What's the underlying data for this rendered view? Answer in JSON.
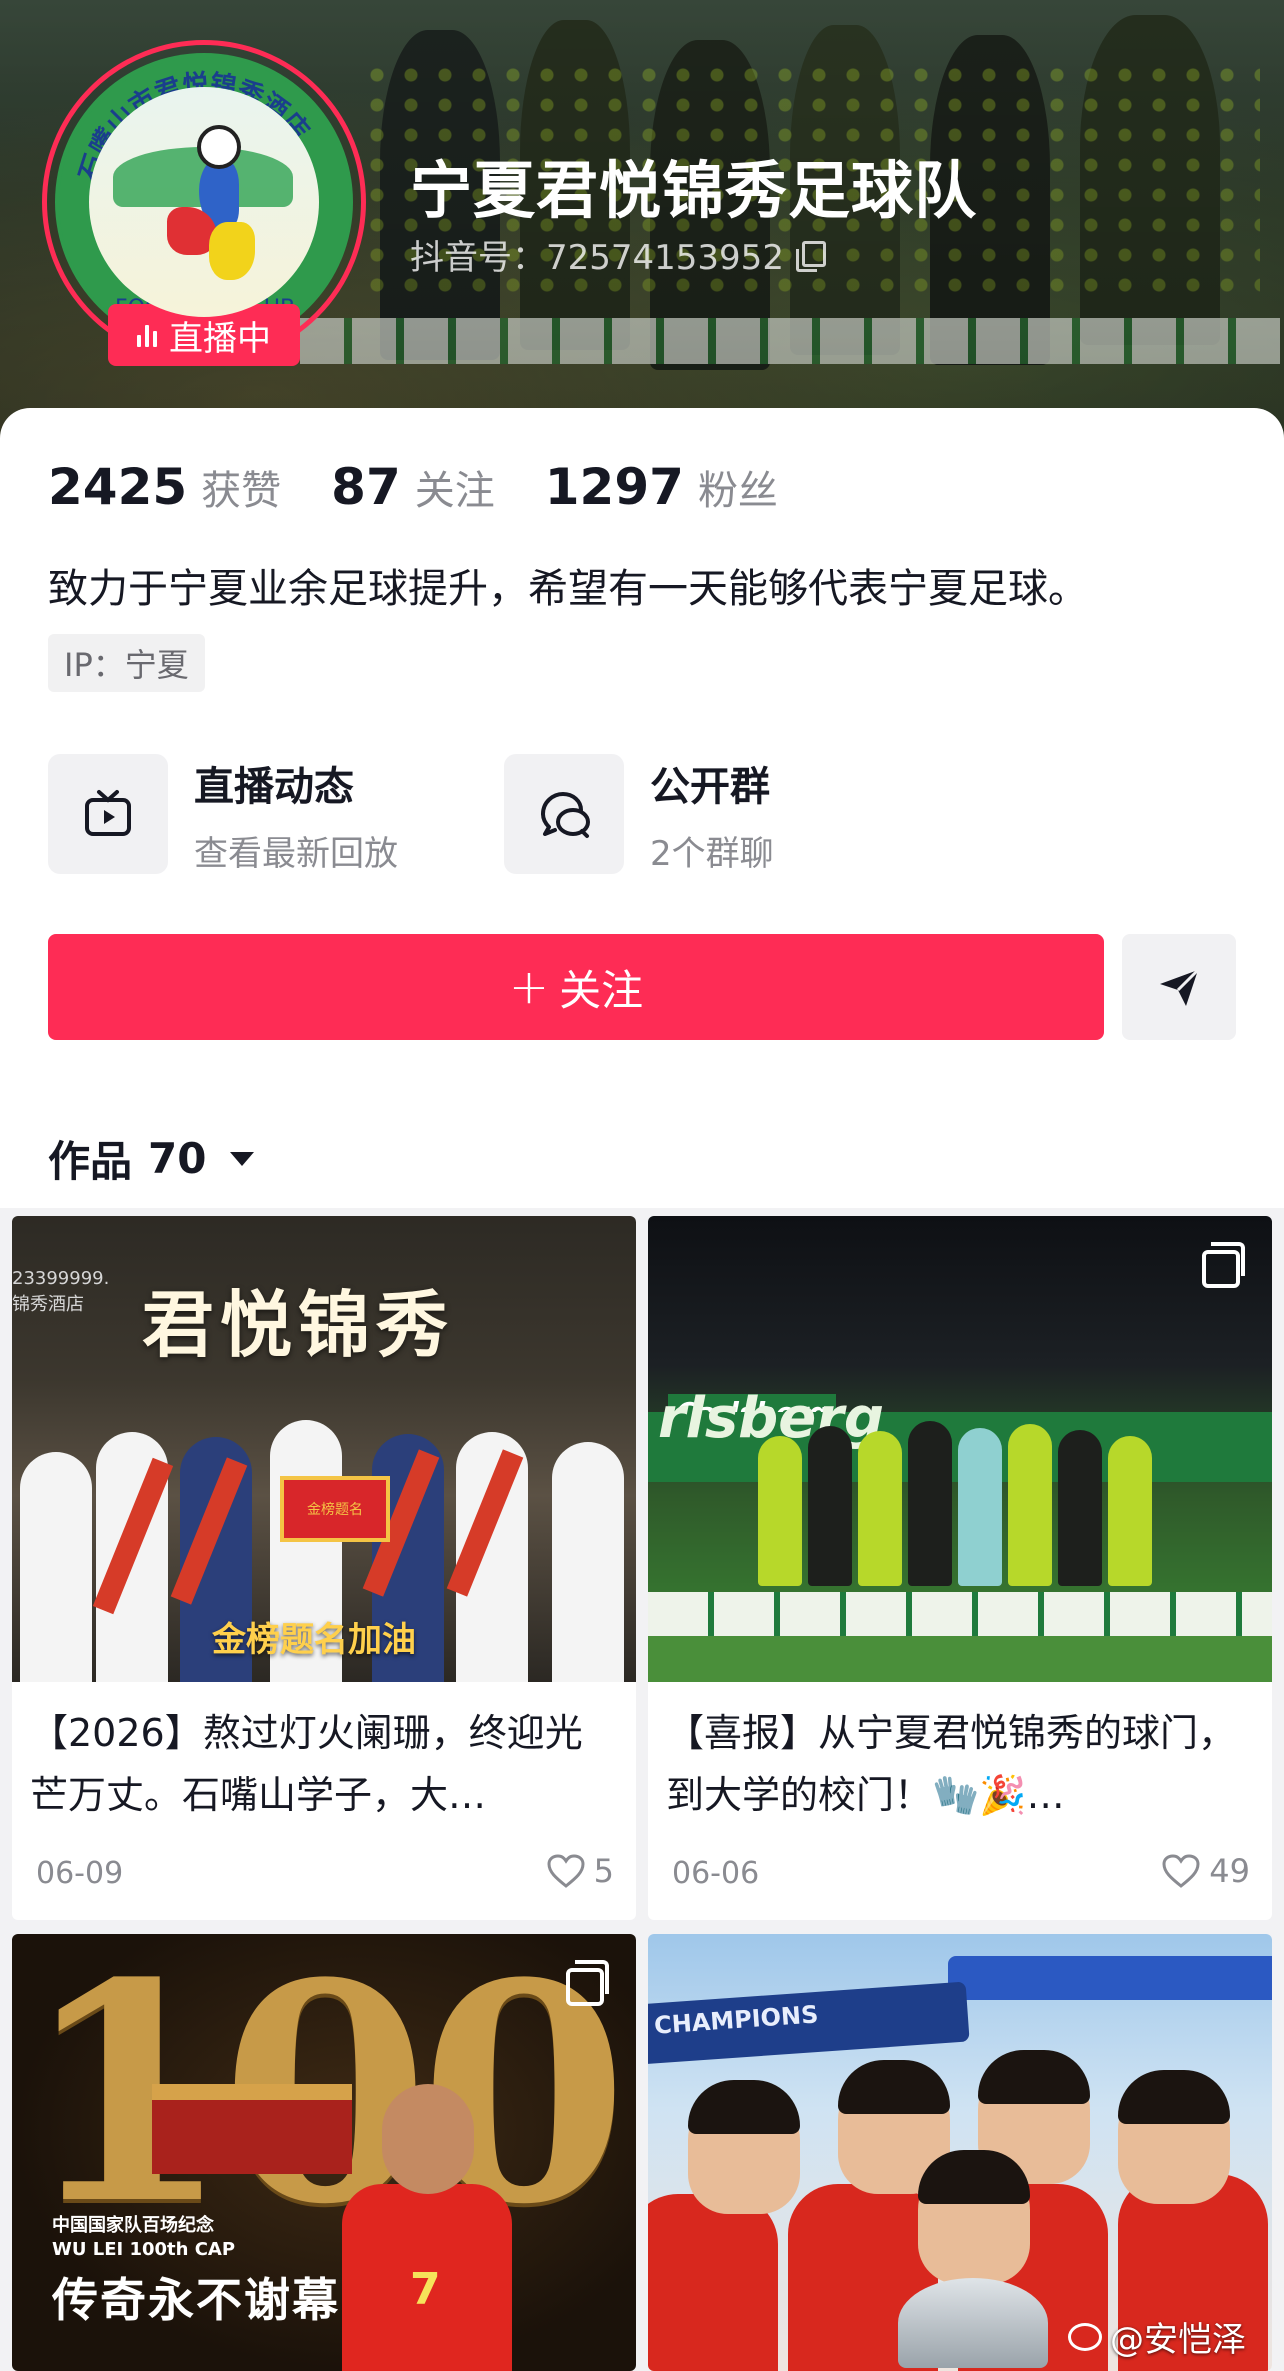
{
  "profile": {
    "name": "宁夏君悦锦秀足球队",
    "douyin_id": "抖音号：72574153952",
    "live_badge": "直播中",
    "stats": [
      {
        "value": "2425",
        "label": "获赞"
      },
      {
        "value": "87",
        "label": "关注"
      },
      {
        "value": "1297",
        "label": "粉丝"
      }
    ],
    "bio": "致力于宁夏业余足球提升，希望有一天能够代表宁夏足球。",
    "ip": "IP：宁夏",
    "avatar_ring_text": "石嘴山市君悦锦秀酒店",
    "avatar_bottom_text": "FOOTBALL CLUB"
  },
  "features": [
    {
      "title": "直播动态",
      "subtitle": "查看最新回放",
      "icon": "tv-icon"
    },
    {
      "title": "公开群",
      "subtitle": "2个群聊",
      "icon": "chat-group-icon"
    }
  ],
  "actions": {
    "follow_plus": "+",
    "follow_label": "关注",
    "share_icon": "send-icon"
  },
  "works": {
    "label": "作品",
    "count": "70"
  },
  "posts": [
    {
      "title": "【2026】熬过灯火阑珊，终迎光芒万丈。石嘴山学子，大…",
      "date": "06-09",
      "likes": "5",
      "thumb_heading": "君悦锦秀",
      "thumb_caption": "金榜题名加油",
      "thumb_plaque": "金榜题名",
      "thumb_corner": "23399999.\n锦秀酒店"
    },
    {
      "title": "【喜报】从宁夏君悦锦秀的球门，到大学的校门！🧤🎉…",
      "date": "06-06",
      "likes": "49",
      "thumb_banner": "rlsberg",
      "thumb_top_banner": "Carlsberg"
    },
    {
      "thumb_big": "100",
      "thumb_small": "中国国家队百场纪念\nWU LEI 100th CAP",
      "thumb_big_caption": "传奇永不谢幕",
      "thumb_jersey_number": "7"
    },
    {
      "thumb_arch": "CHAMPIONS",
      "watermark": "@安恺泽"
    }
  ]
}
